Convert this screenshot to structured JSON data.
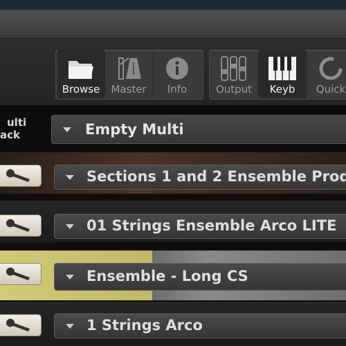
{
  "toolbar": {
    "buttons": [
      {
        "label": "Browse",
        "icon": "folder-icon",
        "active": true
      },
      {
        "label": "Master",
        "icon": "metronome-icon",
        "active": false
      },
      {
        "label": "Info",
        "icon": "info-icon",
        "active": false
      },
      {
        "label": "Output",
        "icon": "mixer-faders-icon",
        "active": false
      },
      {
        "label": "Keyb",
        "icon": "keyboard-icon",
        "active": true
      },
      {
        "label": "Quick",
        "icon": "quick-load-icon",
        "active": false
      }
    ]
  },
  "multi_rack": {
    "label_line1": "ulti",
    "label_line2": "ack",
    "name": "Empty Multi"
  },
  "instruments": [
    {
      "name": "Sections 1 and 2 Ensemble Prod",
      "background": "#3d2a22"
    },
    {
      "name": "01 Strings Ensemble Arco LITE",
      "background": "#232323"
    },
    {
      "name": "Ensemble - Long CS",
      "background": "#c4c06a"
    },
    {
      "name": "1 Strings Arco",
      "background": "#242424"
    }
  ]
}
